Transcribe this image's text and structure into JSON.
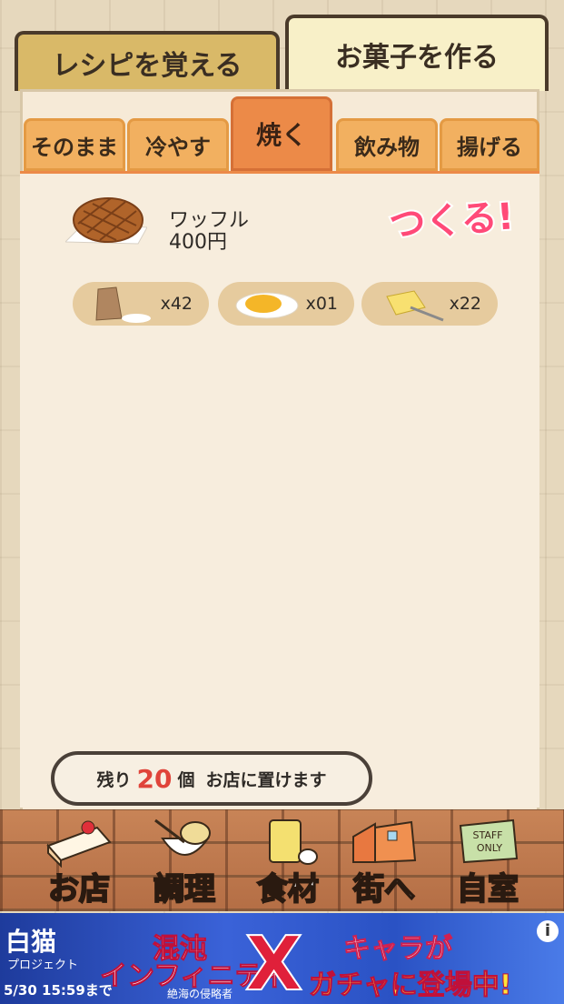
{
  "top_tabs": {
    "learn_recipe": "レシピを覚える",
    "make_sweets": "お菓子を作る"
  },
  "sub_tabs": [
    "そのまま",
    "冷やす",
    "焼く",
    "飲み物",
    "揚げる"
  ],
  "recipe": {
    "name": "ワッフル",
    "price": "400円",
    "make_button": "つくる!"
  },
  "ingredients": [
    {
      "icon": "flour-bag-icon",
      "qty": "x42"
    },
    {
      "icon": "egg-icon",
      "qty": "x01"
    },
    {
      "icon": "butter-icon",
      "qty": "x22"
    }
  ],
  "remaining": {
    "prefix": "残り",
    "count": "20",
    "unit": "個",
    "suffix": "お店に置けます"
  },
  "nav": [
    {
      "label": "お店",
      "icon": "cake-icon"
    },
    {
      "label": "調理",
      "icon": "mixing-bowl-icon"
    },
    {
      "label": "食材",
      "icon": "ingredients-bag-icon"
    },
    {
      "label": "街へ",
      "icon": "town-icon"
    },
    {
      "label": "自室",
      "icon": "staff-only-sign-icon"
    }
  ],
  "ad": {
    "logo": "白猫",
    "logo_sub": "プロジェクト",
    "date": "5/30 15:59まで",
    "title1": "混沌",
    "title2": "インフィニティ",
    "subtitle": "絶海の侵略者",
    "x": "X",
    "right1": "キャラが",
    "right2": "ガチャに登場中!",
    "info": "i"
  },
  "colors": {
    "active_tab": "#ec8a48",
    "sub_tab": "#f2b060",
    "highlight_number": "#e0443a"
  }
}
